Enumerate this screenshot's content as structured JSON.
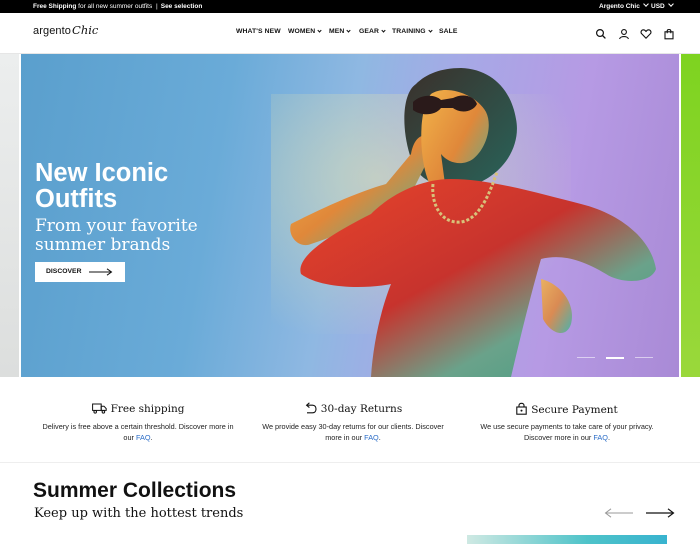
{
  "announcement": {
    "promo_bold": "Free Shipping",
    "promo_text": "for all new summer outfits",
    "promo_sep": "|",
    "promo_link": "See selection",
    "store_selector": "Argento Chic",
    "currency": "USD"
  },
  "header": {
    "logo_part1": "argento",
    "logo_part2": "Chic",
    "nav": [
      {
        "label": "WHAT'S NEW",
        "has_dropdown": false
      },
      {
        "label": "WOMEN",
        "has_dropdown": true
      },
      {
        "label": "MEN",
        "has_dropdown": true
      },
      {
        "label": "GEAR",
        "has_dropdown": true
      },
      {
        "label": "TRAINING",
        "has_dropdown": true
      },
      {
        "label": "SALE",
        "has_dropdown": false
      }
    ],
    "icons": [
      "search-icon",
      "account-icon",
      "wishlist-heart-icon",
      "cart-bag-icon"
    ]
  },
  "hero": {
    "title": "New Iconic Outfits",
    "subtitle": "From your favorite summer brands",
    "cta_label": "DISCOVER",
    "slides_count": 3,
    "active_slide": 2
  },
  "features": [
    {
      "icon": "truck-icon",
      "title": "Free shipping",
      "desc": "Delivery is free above a certain threshold. Discover more in our",
      "link": "FAQ",
      "after": "."
    },
    {
      "icon": "return-arrow-icon",
      "title": "30-day Returns",
      "desc": "We provide easy 30-day returns for our clients. Discover more in our",
      "link": "FAQ",
      "after": "."
    },
    {
      "icon": "lock-icon",
      "title": "Secure Payment",
      "desc": "We use secure payments to take care of your privacy. Discover more in our",
      "link": "FAQ",
      "after": "."
    }
  ],
  "collections": {
    "title": "Summer Collections",
    "subtitle": "Keep up with the hottest trends"
  },
  "colors": {
    "topbar_bg": "#000000",
    "link": "#2a6cc7",
    "hero_left": "#5a9fcd",
    "hero_right": "#b69ae4",
    "next_slide_peek": "#7ed320"
  }
}
